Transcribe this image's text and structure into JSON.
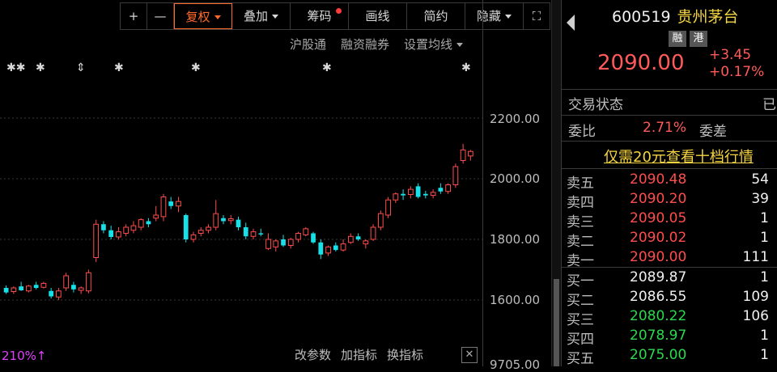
{
  "toolbar": {
    "buttons": [
      "+",
      "—",
      "复权",
      "叠加",
      "筹码",
      "画线",
      "简约",
      "隐藏",
      "⛶"
    ]
  },
  "subbar": [
    "沪股通",
    "融资融券",
    "设置均线"
  ],
  "markers": [
    "✱✱",
    "✱",
    "⇕",
    "✱",
    "✱",
    "✱",
    "✱"
  ],
  "yaxis": {
    "labels": [
      "2200.00",
      "2000.00",
      "1800.00",
      "1600.00",
      "9705.00"
    ]
  },
  "bottom": {
    "left_text": "210%↑",
    "buttons": [
      "改参数",
      "加指标",
      "换指标"
    ],
    "close": "✕"
  },
  "stock": {
    "code": "600519",
    "name": "贵州茅台",
    "tags": [
      "融",
      "港"
    ],
    "price": "2090.00",
    "change": "+3.45",
    "change_pct": "+0.17%"
  },
  "status": {
    "label": "交易状态",
    "value": "已"
  },
  "ratio": {
    "label": "委比",
    "value": "2.71%",
    "diff_label": "委差"
  },
  "promo": "仅需20元查看十档行情",
  "orderbook": {
    "asks": [
      {
        "label": "卖五",
        "price": "2090.48",
        "vol": "54"
      },
      {
        "label": "卖四",
        "price": "2090.20",
        "vol": "39"
      },
      {
        "label": "卖三",
        "price": "2090.05",
        "vol": "1"
      },
      {
        "label": "卖二",
        "price": "2090.02",
        "vol": "1"
      },
      {
        "label": "卖一",
        "price": "2090.00",
        "vol": "111"
      }
    ],
    "bids": [
      {
        "label": "买一",
        "price": "2089.87",
        "vol": "1"
      },
      {
        "label": "买二",
        "price": "2086.55",
        "vol": "109"
      },
      {
        "label": "买三",
        "price": "2080.22",
        "vol": "106"
      },
      {
        "label": "买四",
        "price": "2078.97",
        "vol": "1"
      },
      {
        "label": "买五",
        "price": "2075.00",
        "vol": "1"
      }
    ]
  },
  "colors": {
    "up": "#ff4d4d",
    "down": "#18e0e8",
    "accent": "#ff6a2a",
    "gold": "#f5d442",
    "green": "#2bd94e"
  },
  "chart_data": {
    "type": "candlestick",
    "y_axis_labels": [
      "2200.00",
      "2000.00",
      "1800.00",
      "1600.00"
    ],
    "ylim": [
      1575,
      2235
    ],
    "candles": [
      {
        "o": 1640,
        "h": 1648,
        "l": 1620,
        "c": 1625,
        "dir": "down"
      },
      {
        "o": 1628,
        "h": 1645,
        "l": 1620,
        "c": 1640,
        "dir": "up"
      },
      {
        "o": 1645,
        "h": 1660,
        "l": 1630,
        "c": 1632,
        "dir": "down"
      },
      {
        "o": 1630,
        "h": 1650,
        "l": 1625,
        "c": 1646,
        "dir": "up"
      },
      {
        "o": 1650,
        "h": 1660,
        "l": 1635,
        "c": 1640,
        "dir": "down"
      },
      {
        "o": 1642,
        "h": 1660,
        "l": 1638,
        "c": 1655,
        "dir": "up"
      },
      {
        "o": 1630,
        "h": 1640,
        "l": 1605,
        "c": 1612,
        "dir": "down"
      },
      {
        "o": 1610,
        "h": 1640,
        "l": 1600,
        "c": 1630,
        "dir": "up"
      },
      {
        "o": 1640,
        "h": 1690,
        "l": 1630,
        "c": 1680,
        "dir": "up"
      },
      {
        "o": 1650,
        "h": 1660,
        "l": 1625,
        "c": 1635,
        "dir": "down"
      },
      {
        "o": 1632,
        "h": 1645,
        "l": 1620,
        "c": 1640,
        "dir": "up"
      },
      {
        "o": 1630,
        "h": 1700,
        "l": 1622,
        "c": 1690,
        "dir": "up"
      },
      {
        "o": 1740,
        "h": 1865,
        "l": 1725,
        "c": 1850,
        "dir": "up"
      },
      {
        "o": 1850,
        "h": 1860,
        "l": 1820,
        "c": 1830,
        "dir": "down"
      },
      {
        "o": 1830,
        "h": 1845,
        "l": 1800,
        "c": 1808,
        "dir": "down"
      },
      {
        "o": 1808,
        "h": 1840,
        "l": 1800,
        "c": 1825,
        "dir": "up"
      },
      {
        "o": 1820,
        "h": 1850,
        "l": 1810,
        "c": 1840,
        "dir": "up"
      },
      {
        "o": 1830,
        "h": 1860,
        "l": 1820,
        "c": 1845,
        "dir": "up"
      },
      {
        "o": 1840,
        "h": 1870,
        "l": 1830,
        "c": 1865,
        "dir": "up"
      },
      {
        "o": 1860,
        "h": 1870,
        "l": 1840,
        "c": 1850,
        "dir": "down"
      },
      {
        "o": 1870,
        "h": 1910,
        "l": 1860,
        "c": 1880,
        "dir": "up"
      },
      {
        "o": 1875,
        "h": 1950,
        "l": 1860,
        "c": 1940,
        "dir": "up"
      },
      {
        "o": 1925,
        "h": 1940,
        "l": 1900,
        "c": 1910,
        "dir": "down"
      },
      {
        "o": 1910,
        "h": 1940,
        "l": 1890,
        "c": 1925,
        "dir": "up"
      },
      {
        "o": 1880,
        "h": 1885,
        "l": 1790,
        "c": 1800,
        "dir": "down"
      },
      {
        "o": 1800,
        "h": 1825,
        "l": 1790,
        "c": 1815,
        "dir": "up"
      },
      {
        "o": 1820,
        "h": 1840,
        "l": 1810,
        "c": 1830,
        "dir": "up"
      },
      {
        "o": 1830,
        "h": 1850,
        "l": 1820,
        "c": 1840,
        "dir": "up"
      },
      {
        "o": 1840,
        "h": 1930,
        "l": 1830,
        "c": 1885,
        "dir": "up"
      },
      {
        "o": 1870,
        "h": 1880,
        "l": 1850,
        "c": 1860,
        "dir": "down"
      },
      {
        "o": 1862,
        "h": 1880,
        "l": 1850,
        "c": 1868,
        "dir": "up"
      },
      {
        "o": 1865,
        "h": 1875,
        "l": 1830,
        "c": 1840,
        "dir": "down"
      },
      {
        "o": 1840,
        "h": 1855,
        "l": 1800,
        "c": 1810,
        "dir": "down"
      },
      {
        "o": 1810,
        "h": 1835,
        "l": 1800,
        "c": 1825,
        "dir": "up"
      },
      {
        "o": 1820,
        "h": 1835,
        "l": 1810,
        "c": 1818,
        "dir": "down"
      },
      {
        "o": 1800,
        "h": 1820,
        "l": 1765,
        "c": 1770,
        "dir": "up"
      },
      {
        "o": 1775,
        "h": 1800,
        "l": 1760,
        "c": 1795,
        "dir": "up"
      },
      {
        "o": 1800,
        "h": 1815,
        "l": 1775,
        "c": 1780,
        "dir": "down"
      },
      {
        "o": 1780,
        "h": 1805,
        "l": 1770,
        "c": 1800,
        "dir": "up"
      },
      {
        "o": 1800,
        "h": 1825,
        "l": 1790,
        "c": 1820,
        "dir": "up"
      },
      {
        "o": 1815,
        "h": 1840,
        "l": 1810,
        "c": 1835,
        "dir": "up"
      },
      {
        "o": 1820,
        "h": 1825,
        "l": 1785,
        "c": 1790,
        "dir": "down"
      },
      {
        "o": 1790,
        "h": 1800,
        "l": 1735,
        "c": 1750,
        "dir": "down"
      },
      {
        "o": 1755,
        "h": 1780,
        "l": 1745,
        "c": 1775,
        "dir": "up"
      },
      {
        "o": 1780,
        "h": 1790,
        "l": 1760,
        "c": 1765,
        "dir": "down"
      },
      {
        "o": 1765,
        "h": 1800,
        "l": 1760,
        "c": 1785,
        "dir": "up"
      },
      {
        "o": 1790,
        "h": 1820,
        "l": 1785,
        "c": 1810,
        "dir": "up"
      },
      {
        "o": 1810,
        "h": 1820,
        "l": 1795,
        "c": 1800,
        "dir": "down"
      },
      {
        "o": 1785,
        "h": 1800,
        "l": 1770,
        "c": 1795,
        "dir": "up"
      },
      {
        "o": 1800,
        "h": 1850,
        "l": 1795,
        "c": 1840,
        "dir": "up"
      },
      {
        "o": 1840,
        "h": 1895,
        "l": 1830,
        "c": 1885,
        "dir": "up"
      },
      {
        "o": 1880,
        "h": 1940,
        "l": 1870,
        "c": 1930,
        "dir": "up"
      },
      {
        "o": 1930,
        "h": 1955,
        "l": 1920,
        "c": 1950,
        "dir": "up"
      },
      {
        "o": 1950,
        "h": 1965,
        "l": 1930,
        "c": 1945,
        "dir": "down"
      },
      {
        "o": 1948,
        "h": 1975,
        "l": 1935,
        "c": 1965,
        "dir": "up"
      },
      {
        "o": 1975,
        "h": 1985,
        "l": 1935,
        "c": 1940,
        "dir": "down"
      },
      {
        "o": 1950,
        "h": 1960,
        "l": 1935,
        "c": 1945,
        "dir": "down"
      },
      {
        "o": 1945,
        "h": 1965,
        "l": 1935,
        "c": 1955,
        "dir": "up"
      },
      {
        "o": 1970,
        "h": 1985,
        "l": 1950,
        "c": 1958,
        "dir": "down"
      },
      {
        "o": 1958,
        "h": 1985,
        "l": 1950,
        "c": 1980,
        "dir": "up"
      },
      {
        "o": 1980,
        "h": 2050,
        "l": 1970,
        "c": 2040,
        "dir": "up"
      },
      {
        "o": 2060,
        "h": 2115,
        "l": 2050,
        "c": 2095,
        "dir": "up"
      },
      {
        "o": 2075,
        "h": 2095,
        "l": 2060,
        "c": 2090,
        "dir": "up"
      }
    ]
  }
}
